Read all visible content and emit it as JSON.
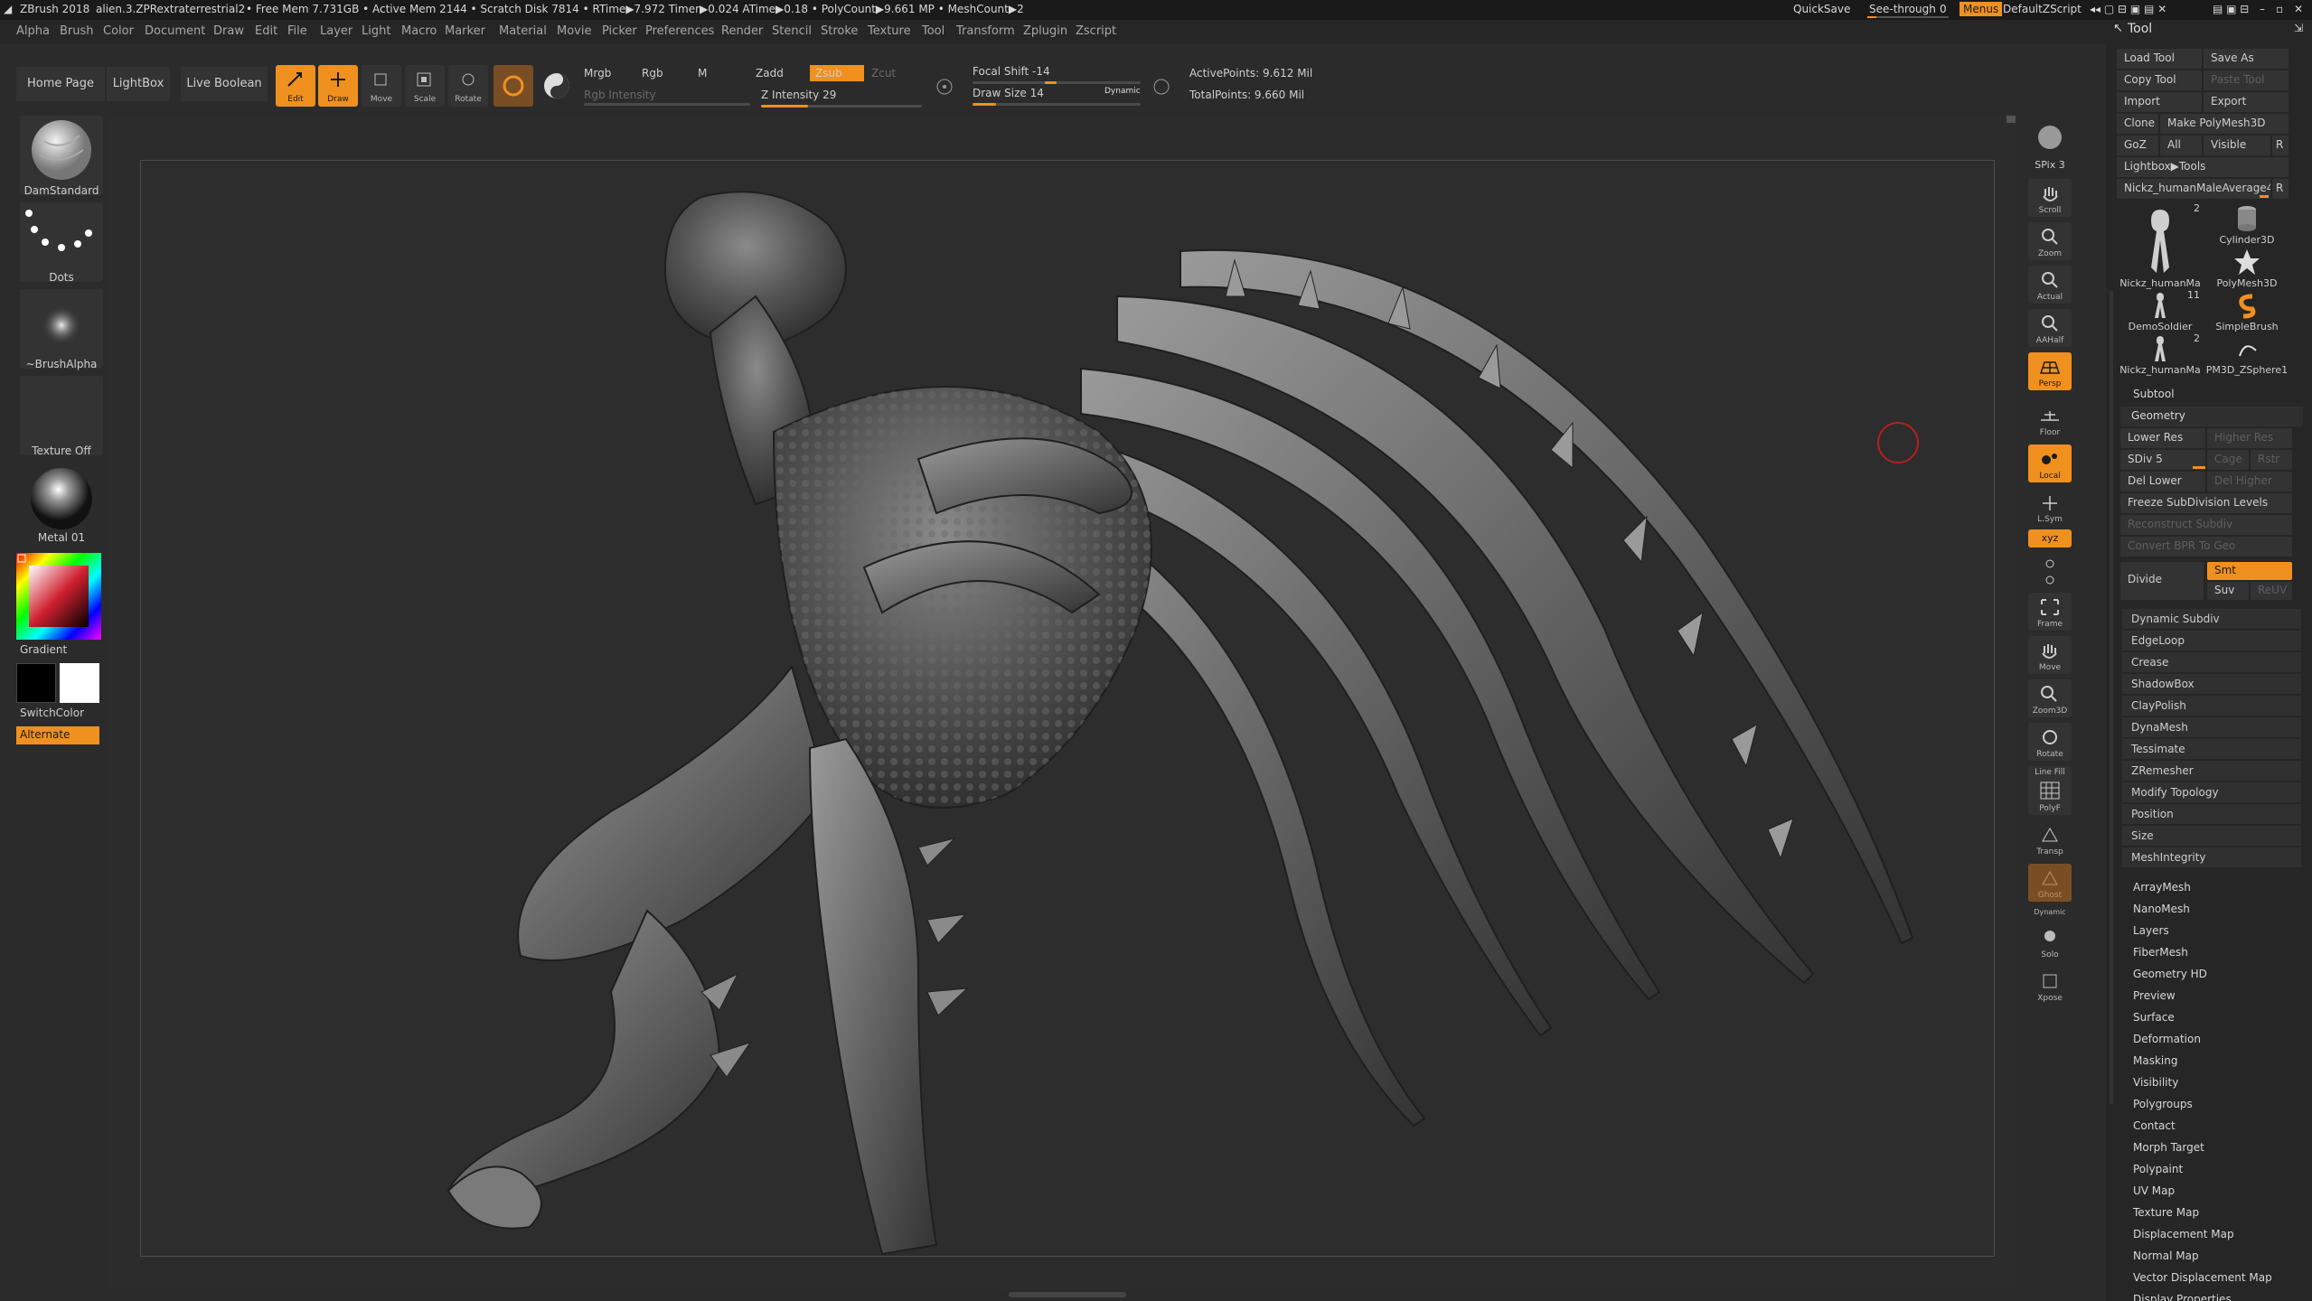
{
  "titlebar": {
    "app": "ZBrush 2018",
    "file": "alien.3.ZPRextraterrestrial2",
    "stats": "• Free Mem 7.731GB • Active Mem 2144 • Scratch Disk 7814 • RTime▶7.972 Timer▶0.024 ATime▶0.18 • PolyCount▶9.661 MP • MeshCount▶2",
    "quicksave": "QuickSave",
    "seethrough": "See-through",
    "seethrough_value": "0",
    "menus": "Menus",
    "script": "DefaultZScript"
  },
  "menubar": [
    "Alpha",
    "Brush",
    "Color",
    "Document",
    "Draw",
    "Edit",
    "File",
    "Layer",
    "Light",
    "Macro",
    "Marker",
    "Material",
    "Movie",
    "Picker",
    "Preferences",
    "Render",
    "Stencil",
    "Stroke",
    "Texture",
    "Tool",
    "Transform",
    "Zplugin",
    "Zscript"
  ],
  "shelf": {
    "home": "Home Page",
    "lightbox": "LightBox",
    "liveboolean": "Live Boolean",
    "edit": "Edit",
    "draw": "Draw",
    "move": "Move",
    "scale": "Scale",
    "rotate": "Rotate",
    "mrgb": "Mrgb",
    "rgb": "Rgb",
    "m": "M",
    "rgb_intensity": "Rgb Intensity",
    "zadd": "Zadd",
    "zsub": "Zsub",
    "zcut": "Zcut",
    "z_intensity": "Z Intensity 29",
    "focal_shift": "Focal Shift -14",
    "draw_size": "Draw Size 14",
    "dynamic": "Dynamic",
    "active_points": "ActivePoints: 9.612 Mil",
    "total_points": "TotalPoints: 9.660 Mil",
    "z_intensity_value": 29,
    "focal_shift_value": -14,
    "draw_size_value": 14
  },
  "lefttray": {
    "brush": "DamStandard",
    "stroke": "Dots",
    "alpha": "~BrushAlpha",
    "texture": "Texture Off",
    "material": "Metal 01",
    "gradient": "Gradient",
    "switchcolor": "SwitchColor",
    "alternate": "Alternate"
  },
  "rightshelf": {
    "spix": "SPix 3",
    "scroll": "Scroll",
    "zoom": "Zoom",
    "actual": "Actual",
    "aahalf": "AAHalf",
    "persp": "Persp",
    "floor": "Floor",
    "local": "Local",
    "lsym": "L.Sym",
    "xyz": "xyz",
    "frame": "Frame",
    "move": "Move",
    "zoom3d": "Zoom3D",
    "rotate": "Rotate",
    "linefill": "Line Fill",
    "polyf": "PolyF",
    "transp": "Transp",
    "ghost": "Ghost",
    "dynamic": "Dynamic",
    "solo": "Solo",
    "xpose": "Xpose"
  },
  "palette": {
    "title": "Tool",
    "load_tool": "Load Tool",
    "save_as": "Save As",
    "copy_tool": "Copy Tool",
    "paste_tool": "Paste Tool",
    "import": "Import",
    "export": "Export",
    "clone": "Clone",
    "make_polymesh": "Make PolyMesh3D",
    "goz": "GoZ",
    "all": "All",
    "visible": "Visible",
    "r": "R",
    "lightbox_tools": "Lightbox▶Tools",
    "current_tool": "Nickz_humanMaleAverage4",
    "tools": [
      {
        "name": "Nickz_humanMa",
        "count": "2"
      },
      {
        "name": "Cylinder3D",
        "count": ""
      },
      {
        "name": "PolyMesh3D",
        "count": ""
      },
      {
        "name": "DemoSoldier",
        "count": "11"
      },
      {
        "name": "SimpleBrush",
        "count": ""
      },
      {
        "name": "Nickz_humanMa",
        "count": "2"
      },
      {
        "name": "PM3D_ZSphere1",
        "count": ""
      }
    ],
    "subtool": "Subtool",
    "geometry": "Geometry",
    "lower_res": "Lower Res",
    "higher_res": "Higher Res",
    "sdiv": "SDiv 5",
    "cage": "Cage",
    "rstr": "Rstr",
    "del_lower": "Del Lower",
    "del_higher": "Del Higher",
    "freeze": "Freeze SubDivision Levels",
    "reconstruct": "Reconstruct Subdiv",
    "convert_bpr": "Convert BPR To Geo",
    "divide": "Divide",
    "smt": "Smt",
    "suv": "Suv",
    "reuv": "ReUV",
    "geometry_items": [
      "Dynamic Subdiv",
      "EdgeLoop",
      "Crease",
      "ShadowBox",
      "ClayPolish",
      "DynaMesh",
      "Tessimate",
      "ZRemesher",
      "Modify Topology",
      "Position",
      "Size",
      "MeshIntegrity"
    ],
    "sections": [
      "ArrayMesh",
      "NanoMesh",
      "Layers",
      "FiberMesh",
      "Geometry HD",
      "Preview",
      "Surface",
      "Deformation",
      "Masking",
      "Visibility",
      "Polygroups",
      "Contact",
      "Morph Target",
      "Polypaint",
      "UV Map",
      "Texture Map",
      "Displacement Map",
      "Normal Map",
      "Vector Displacement Map",
      "Display Properties"
    ]
  }
}
